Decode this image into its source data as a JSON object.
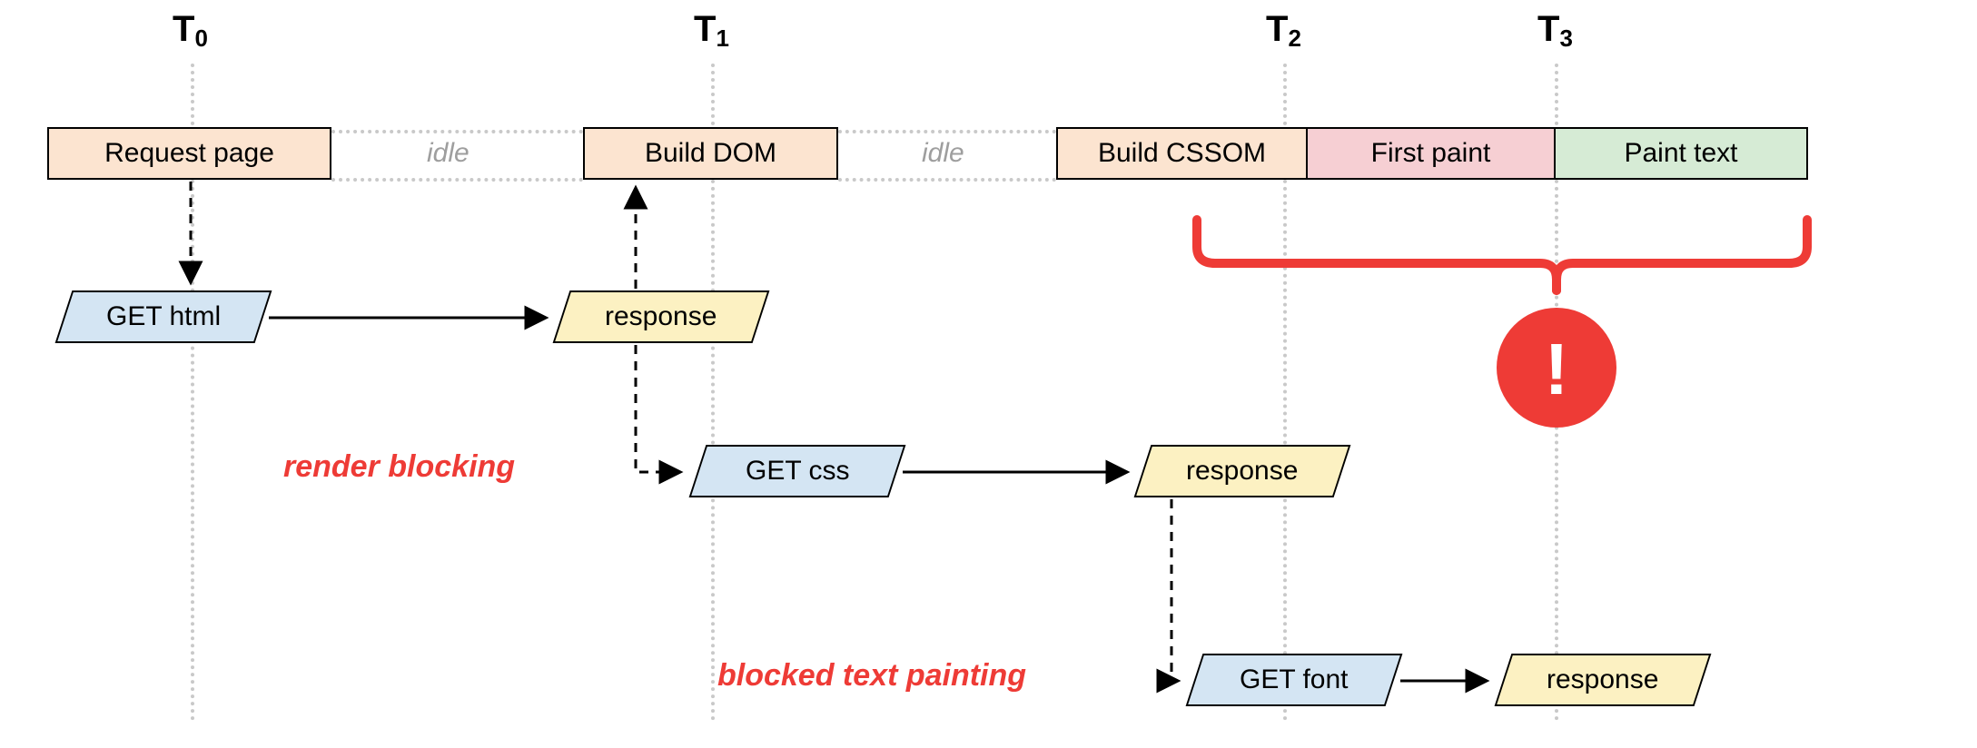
{
  "time_markers": {
    "t0": "T",
    "t0_sub": "0",
    "t1": "T",
    "t1_sub": "1",
    "t2": "T",
    "t2_sub": "2",
    "t3": "T",
    "t3_sub": "3"
  },
  "row_top": {
    "request_page": "Request page",
    "build_dom": "Build DOM",
    "build_cssom": "Build CSSOM",
    "first_paint": "First paint",
    "paint_text": "Paint text",
    "idle1": "idle",
    "idle2": "idle"
  },
  "net": {
    "get_html": "GET html",
    "resp_html": "response",
    "get_css": "GET css",
    "resp_css": "response",
    "get_font": "GET font",
    "resp_font": "response"
  },
  "annotations": {
    "render_blocking": "render blocking",
    "blocked_text": "blocked text painting"
  },
  "alert_glyph": "!"
}
